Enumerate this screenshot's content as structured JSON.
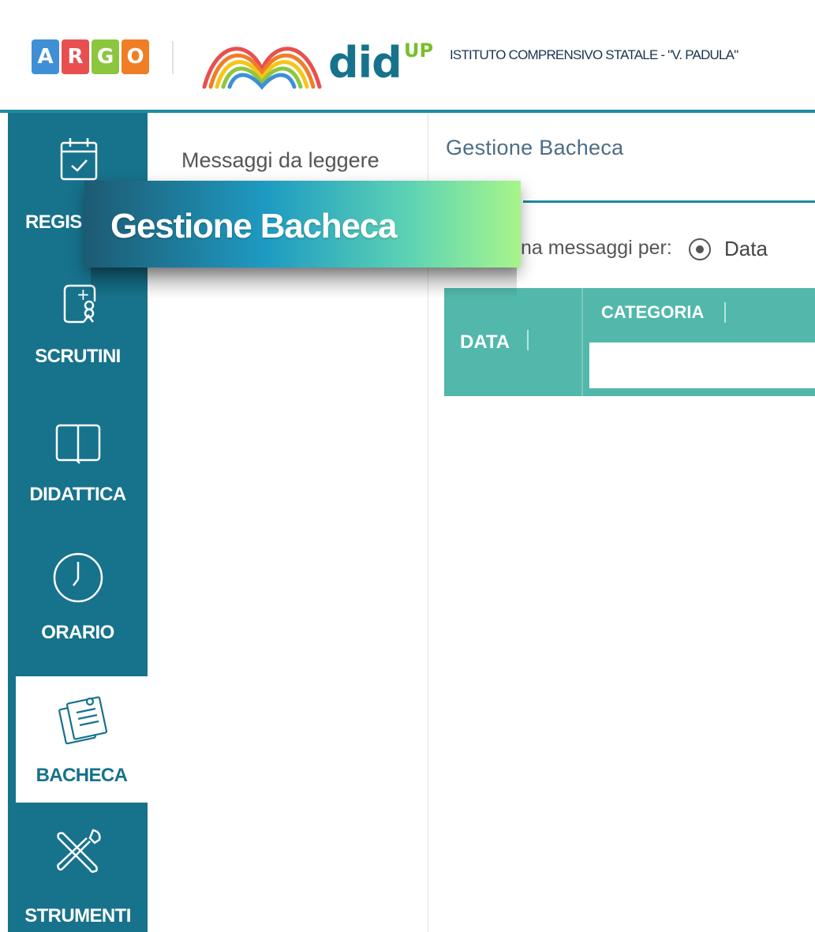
{
  "header": {
    "argo_letters": [
      {
        "letter": "A",
        "color": "#3f8fd6"
      },
      {
        "letter": "R",
        "color": "#e94f4f"
      },
      {
        "letter": "G",
        "color": "#8cc63f"
      },
      {
        "letter": "O",
        "color": "#f07e26"
      }
    ],
    "app_name": "did",
    "app_suffix": "UP",
    "school_name": "ISTITUTO COMPRENSIVO STATALE - \"V. PADULA\""
  },
  "sidebar": {
    "items": [
      {
        "label": "REGIS",
        "icon": "calendar-check-icon"
      },
      {
        "label": "SCRUTINI",
        "icon": "scrutini-icon"
      },
      {
        "label": "DIDATTICA",
        "icon": "book-icon"
      },
      {
        "label": "ORARIO",
        "icon": "clock-icon"
      },
      {
        "label": "BACHECA",
        "icon": "notice-board-icon",
        "active": true
      },
      {
        "label": "STRUMENTI",
        "icon": "tools-icon"
      }
    ]
  },
  "sub_panel": {
    "items": [
      {
        "label": "Messaggi da leggere"
      }
    ]
  },
  "main": {
    "breadcrumb": "Gestione Bacheca",
    "sort_text": "na messaggi per:",
    "sort_option": "Data",
    "table": {
      "columns": [
        {
          "label": "DATA"
        },
        {
          "label": "CATEGORIA"
        }
      ]
    }
  },
  "overlay": {
    "title": "Gestione Bacheca"
  },
  "colors": {
    "sidebar": "#17728c",
    "header_line": "#1f8aa0",
    "table_header": "#52b8ab"
  }
}
